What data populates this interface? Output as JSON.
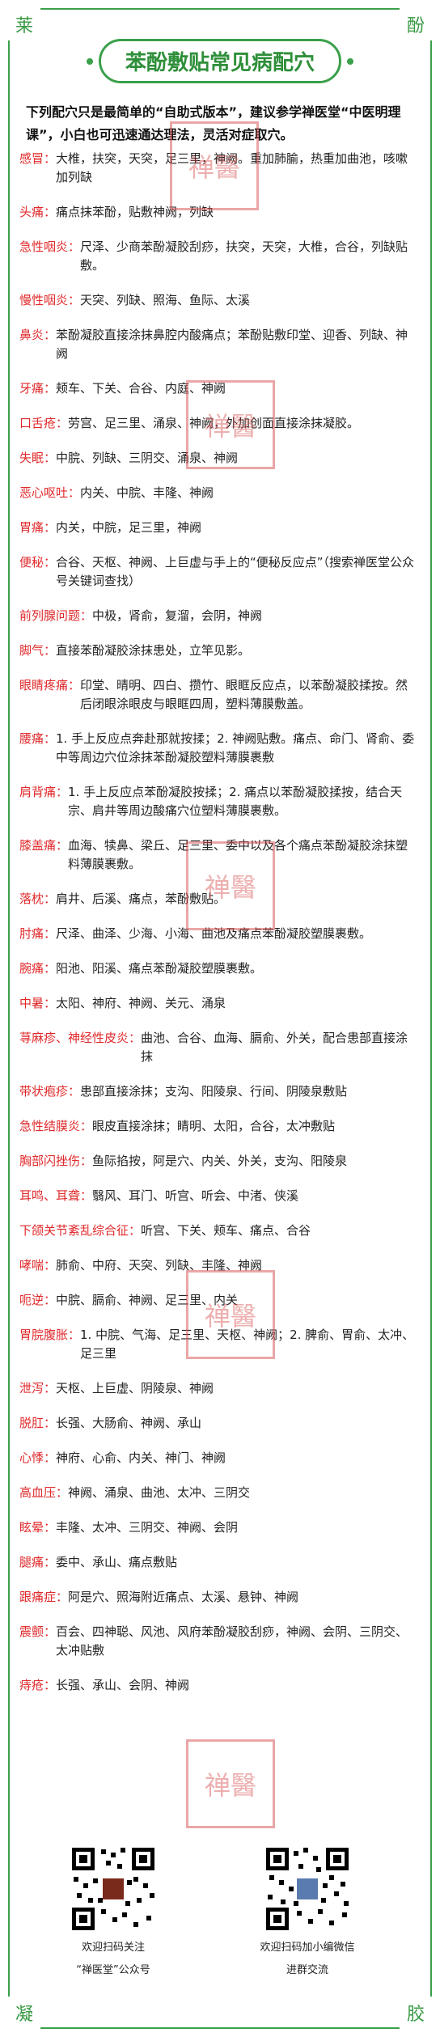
{
  "corners": {
    "tl": "莱",
    "tr": "酚",
    "bl": "凝",
    "br": "胶"
  },
  "title": "苯酚敷贴常见病配穴",
  "intro": "下列配穴只是最简单的“自助式版本”，建议参学禅医堂“中医明理课”，小白也可迅速通达理法，灵活对症取穴。",
  "entries": [
    {
      "name": "感冒：",
      "text": "大椎，扶突，天突，足三里，神阙。重加肺腧，热重加曲池，咳嗽加列缺"
    },
    {
      "name": "头痛：",
      "text": "痛点抹苯酚，贴敷神阙，列缺"
    },
    {
      "name": "急性咽炎：",
      "text": "尺泽、少商苯酚凝胶刮痧，扶突，天突，大椎，合谷，列缺贴敷。"
    },
    {
      "name": "慢性咽炎：",
      "text": "天突、列缺、照海、鱼际、太溪"
    },
    {
      "name": "鼻炎：",
      "text": "苯酚凝胶直接涂抹鼻腔内酸痛点；苯酚贴敷印堂、迎香、列缺、神阙"
    },
    {
      "name": "牙痛：",
      "text": "颊车、下关、合谷、内庭、神阙"
    },
    {
      "name": "口舌疮：",
      "text": "劳宫、足三里、涌泉、神阙，外加创面直接涂抹凝胶。"
    },
    {
      "name": "失眠：",
      "text": "中脘、列缺、三阴交、涌泉、神阙"
    },
    {
      "name": "恶心呕吐：",
      "text": "内关、中脘、丰隆、神阙"
    },
    {
      "name": "胃痛：",
      "text": "内关，中脘，足三里，神阙"
    },
    {
      "name": "便秘：",
      "text": "合谷、天枢、神阙、上巨虚与手上的“便秘反应点”（搜索禅医堂公众号关键词查找）"
    },
    {
      "name": "前列腺问题：",
      "text": "中极，肾俞，复溜，会阴，神阙"
    },
    {
      "name": "脚气：",
      "text": "直接苯酚凝胶涂抹患处，立竿见影。"
    },
    {
      "name": "眼睛疼痛：",
      "text": "印堂、晴明、四白、攒竹、眼眶反应点，以苯酚凝胶揉按。然后闭眼涂眼皮与眼眶四周，塑料薄膜敷盖。"
    },
    {
      "name": "腰痛：",
      "text": "1. 手上反应点奔赴那就按揉；2. 神阙贴敷。痛点、命门、肾俞、委中等周边穴位涂抹苯酚凝胶塑料薄膜裹敷"
    },
    {
      "name": "肩背痛：",
      "text": "1. 手上反应点苯酚凝胶按揉；2. 痛点以苯酚凝胶揉按，结合天宗、肩井等周边酸痛穴位塑料薄膜裹敷。"
    },
    {
      "name": "膝盖痛：",
      "text": "血海、犊鼻、梁丘、足三里、委中以及各个痛点苯酚凝胶涂抹塑料薄膜裹敷。"
    },
    {
      "name": "落枕：",
      "text": "肩井、后溪、痛点，苯酚敷贴。"
    },
    {
      "name": "肘痛：",
      "text": "尺泽、曲泽、少海、小海、曲池及痛点苯酚凝胶塑膜裹敷。"
    },
    {
      "name": "腕痛：",
      "text": "阳池、阳溪、痛点苯酚凝胶塑膜裹敷。"
    },
    {
      "name": "中暑：",
      "text": "太阳、神府、神阙、关元、涌泉"
    },
    {
      "name": "荨麻疹、神经性皮炎：",
      "text": "曲池、合谷、血海、膈俞、外关，配合患部直接涂抹"
    },
    {
      "name": "带状疱疹：",
      "text": "患部直接涂抹；支沟、阳陵泉、行间、阴陵泉敷贴"
    },
    {
      "name": "急性结膜炎：",
      "text": "眼皮直接涂抹；睛明、太阳，合谷，太冲敷贴"
    },
    {
      "name": "胸部闪挫伤：",
      "text": "鱼际掐按，阿是穴、内关、外关，支沟、阳陵泉"
    },
    {
      "name": "耳鸣、耳聋：",
      "text": "翳风、耳门、听宫、听会、中渚、侠溪"
    },
    {
      "name": "下颌关节紊乱综合征：",
      "text": "听宫、下关、颊车、痛点、合谷"
    },
    {
      "name": "哮喘：",
      "text": "肺俞、中府、天突、列缺、丰隆、神阙"
    },
    {
      "name": "呃逆：",
      "text": "中脘、膈俞、神阙、足三里、内关"
    },
    {
      "name": "胃脘腹胀：",
      "text": "1. 中脘、气海、足三里、天枢、神阙；2. 脾俞、胃俞、太冲、足三里"
    },
    {
      "name": "泄泻：",
      "text": "天枢、上巨虚、阴陵泉、神阙"
    },
    {
      "name": "脱肛：",
      "text": "长强、大肠俞、神阙、承山"
    },
    {
      "name": "心悸：",
      "text": "神府、心俞、内关、神门、神阙"
    },
    {
      "name": "高血压：",
      "text": "神阙、涌泉、曲池、太冲、三阴交"
    },
    {
      "name": "眩晕：",
      "text": "丰隆、太冲、三阴交、神阙、会阴"
    },
    {
      "name": "腿痛：",
      "text": "委中、承山、痛点敷贴"
    },
    {
      "name": "跟痛症：",
      "text": "阿是穴、照海附近痛点、太溪、悬钟、神阙"
    },
    {
      "name": "震颤：",
      "text": "百会、四神聪、风池、风府苯酚凝胶刮痧，神阙、会阴、三阴交、太冲贴敷"
    },
    {
      "name": "痔疮：",
      "text": "长强、承山、会阴、神阙"
    }
  ],
  "seals": [
    "禅醫",
    "禅醫",
    "禅醫",
    "禅醫",
    "禅醫"
  ],
  "qr": [
    {
      "caption1": "欢迎扫码关注",
      "caption2": "“禅医堂”公众号"
    },
    {
      "caption1": "欢迎扫码加小编微信",
      "caption2": "进群交流"
    }
  ],
  "colors": {
    "frame": "#3aa04a",
    "heading": "#e0292b",
    "title": "#2f8f3a"
  }
}
